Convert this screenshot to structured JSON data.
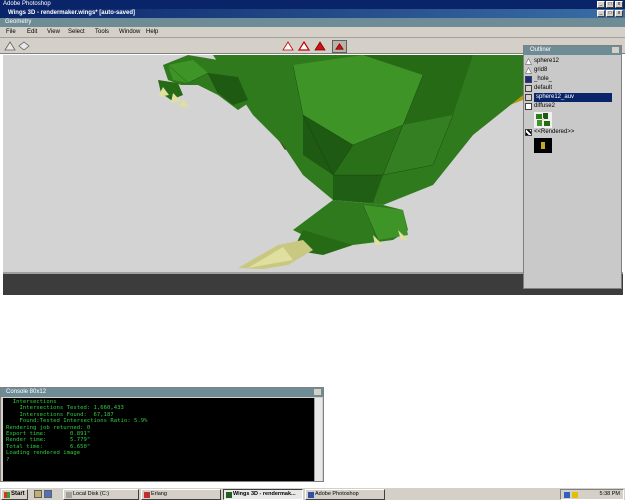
{
  "photoshop": {
    "title": "Adobe Photoshop"
  },
  "wings": {
    "title": "Wings 3D - rendermaker.wings* [auto-saved]",
    "geometry_title": "Geometry",
    "menu": [
      "File",
      "Edit",
      "View",
      "Select",
      "Tools",
      "Window",
      "Help"
    ],
    "toolbar_icons": [
      "vertex-mode-icon",
      "edge-mode-icon",
      "face-mode-icon",
      "body-mode-icon"
    ]
  },
  "outliner": {
    "title": "Outliner",
    "items": [
      {
        "label": "sphere12",
        "icon": "light-icon",
        "selected": false
      },
      {
        "label": "grid8",
        "icon": "light-icon",
        "selected": false
      },
      {
        "label": "_hole_",
        "icon": "material-icon",
        "color": "#1a2a8a",
        "selected": false
      },
      {
        "label": "default",
        "icon": "material-icon",
        "color": "#d4d0c8",
        "selected": false
      },
      {
        "label": "sphere12_auv",
        "icon": "material-icon",
        "color": "#d4d0c8",
        "selected": true
      },
      {
        "label": "diffuse2",
        "icon": "image-icon",
        "selected": false
      },
      {
        "label": "<<Rendered>>",
        "icon": "image-icon",
        "selected": false
      }
    ]
  },
  "console": {
    "title": "Console 80x12",
    "lines": [
      "  Intersections",
      "    Intersections Tested: 1,660,433",
      "    Intersections Found:  67,187",
      "    Found:Tested Intersections Ratio: 5.9%",
      "",
      "Rendering job returned: 0",
      "Export time:       0.891\"",
      "Render time:       5.779\"",
      "Total time:        6.650\"",
      "Loading rendered image",
      "",
      "?"
    ]
  },
  "taskbar": {
    "start": "Start",
    "tasks": [
      {
        "label": "Local Disk (C:)",
        "active": false
      },
      {
        "label": "Erlang",
        "active": false
      },
      {
        "label": "Wings 3D - rendermak...",
        "active": true
      },
      {
        "label": "Adobe Photoshop",
        "active": false
      }
    ],
    "clock": "5:38 PM"
  },
  "colors": {
    "dragon_dark": "#1e5a12",
    "dragon_mid": "#2f7a1d",
    "dragon_light": "#3f9428",
    "claw": "#e0dfa0",
    "viewport_bg": "#d3d3d3"
  }
}
